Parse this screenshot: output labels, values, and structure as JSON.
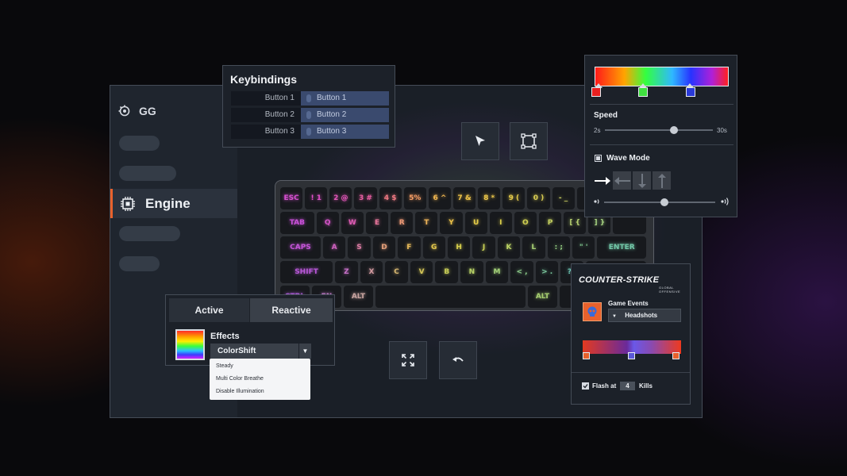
{
  "sidebar": {
    "brand": "GG",
    "active_item": "Engine"
  },
  "keybindings": {
    "title": "Keybindings",
    "rows": [
      {
        "from": "Button 1",
        "to": "Button 1"
      },
      {
        "from": "Button 2",
        "to": "Button 2"
      },
      {
        "from": "Button 3",
        "to": "Button 3"
      }
    ]
  },
  "keyboard": {
    "rows": [
      [
        "ESC",
        "! 1",
        "2 @",
        "3 #",
        "4 $",
        "5%",
        "6 ^",
        "7 &",
        "8 *",
        "9 (",
        "0 )",
        "- _",
        "",
        ""
      ],
      [
        "TAB",
        "Q",
        "W",
        "E",
        "R",
        "T",
        "Y",
        "U",
        "I",
        "O",
        "P",
        "[ {",
        "] }",
        ""
      ],
      [
        "CAPS",
        "A",
        "S",
        "D",
        "F",
        "G",
        "H",
        "J",
        "K",
        "L",
        ": ;",
        "\" '",
        "ENTER"
      ],
      [
        "SHIFT",
        "Z",
        "X",
        "C",
        "V",
        "B",
        "N",
        "M",
        "< ,",
        "> .",
        "? /",
        ""
      ],
      [
        "CTRL",
        "FN",
        "ALT",
        "",
        "ALT",
        "",
        ""
      ]
    ]
  },
  "wave_panel": {
    "gradient_stops": [
      "#e82020",
      "#40e040",
      "#2a3ad8"
    ],
    "speed_label": "Speed",
    "speed_min": "2s",
    "speed_max": "30s",
    "speed_value": 0.64,
    "wave_mode_label": "Wave Mode",
    "wave_mode_checked": true,
    "directions": [
      "arrow-right-icon",
      "arrow-left-icon",
      "arrow-down-icon",
      "arrow-up-icon"
    ],
    "selected_direction": "arrow-right-icon",
    "slider_value": 0.54
  },
  "effects": {
    "tabs": [
      "Active",
      "Reactive"
    ],
    "selected_tab": "Active",
    "label": "Effects",
    "selected": "ColorShift",
    "options": [
      "Steady",
      "Multi Color Breathe",
      "Disable Illumination"
    ]
  },
  "counter_strike": {
    "logo": "COUNTER-STRIKE",
    "subtitle": "GLOBAL OFFENSIVE",
    "game_events_label": "Game Events",
    "game_event": "Headshots",
    "bar_stops": [
      "#e8612c",
      "#5a58d8",
      "#e8612c"
    ],
    "flash_label_pre": "Flash at",
    "flash_value": "4",
    "flash_label_post": "Kills",
    "flash_checked": true
  },
  "colors": {
    "accent": "#e8612c",
    "panel": "#1c2129",
    "binding_highlight": "#3a4a6e"
  }
}
